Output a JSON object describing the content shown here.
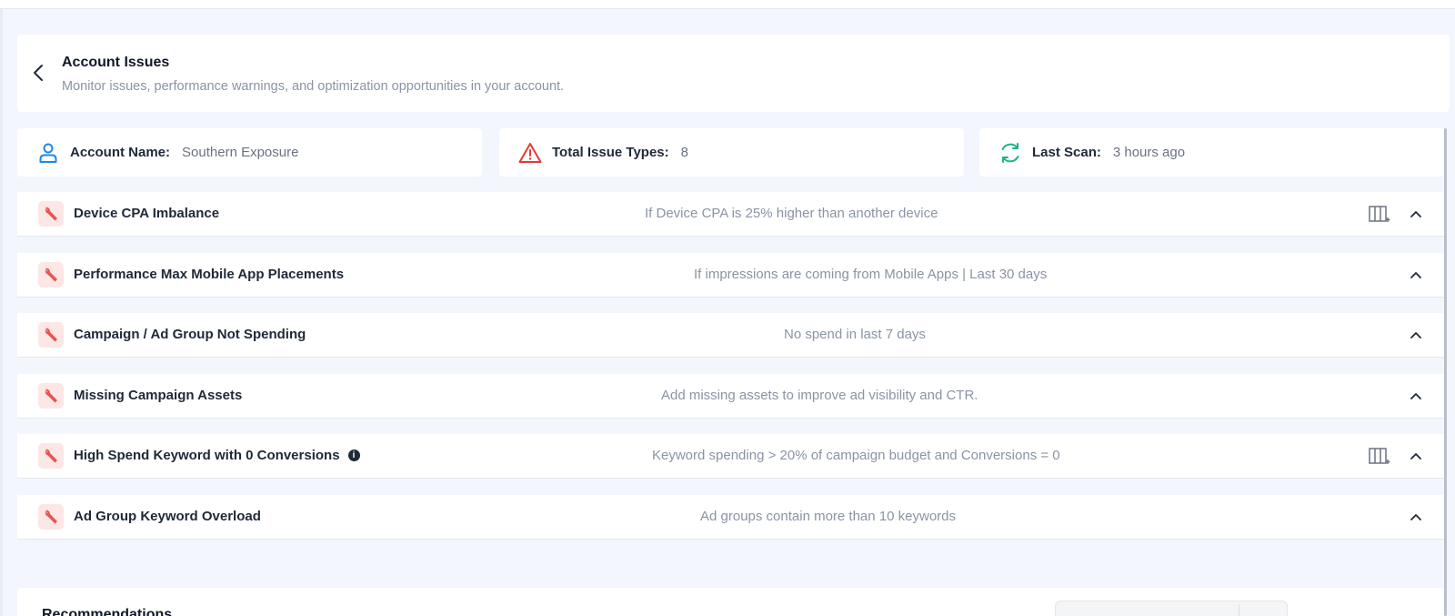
{
  "header": {
    "title": "Account Issues",
    "subtitle": "Monitor issues, performance warnings, and optimization opportunities in your account."
  },
  "summary": {
    "account": {
      "label": "Account Name:",
      "value": "Southern Exposure",
      "icon": "user-icon"
    },
    "issues": {
      "label": "Total Issue Types:",
      "value": "8",
      "icon": "warning-triangle-icon"
    },
    "scan": {
      "label": "Last Scan:",
      "value": "3 hours ago",
      "icon": "refresh-icon"
    }
  },
  "issues": [
    {
      "title": "Device CPA Imbalance",
      "description": "If Device CPA is 25% higher than another device",
      "has_columns_button": true,
      "has_info": false
    },
    {
      "title": "Performance Max Mobile App Placements",
      "description": "If impressions are coming from Mobile Apps | Last 30 days",
      "has_columns_button": false,
      "has_info": false
    },
    {
      "title": "Campaign / Ad Group Not Spending",
      "description": "No spend in last 7 days",
      "has_columns_button": false,
      "has_info": false
    },
    {
      "title": "Missing Campaign Assets",
      "description": "Add missing assets to improve ad visibility and CTR.",
      "has_columns_button": false,
      "has_info": false
    },
    {
      "title": "High Spend Keyword with 0 Conversions",
      "description": "Keyword spending > 20% of campaign budget and Conversions = 0",
      "has_columns_button": true,
      "has_info": true
    },
    {
      "title": "Ad Group Keyword Overload",
      "description": "Ad groups contain more than 10 keywords",
      "has_columns_button": false,
      "has_info": false
    }
  ],
  "recommendations": {
    "title": "Recommendations"
  },
  "colors": {
    "accent_blue": "#1e88e5",
    "warning_red": "#e53935",
    "refresh_green": "#1db38a",
    "issue_icon_bg": "#fde6e6",
    "issue_icon_fg": "#e4564f"
  }
}
